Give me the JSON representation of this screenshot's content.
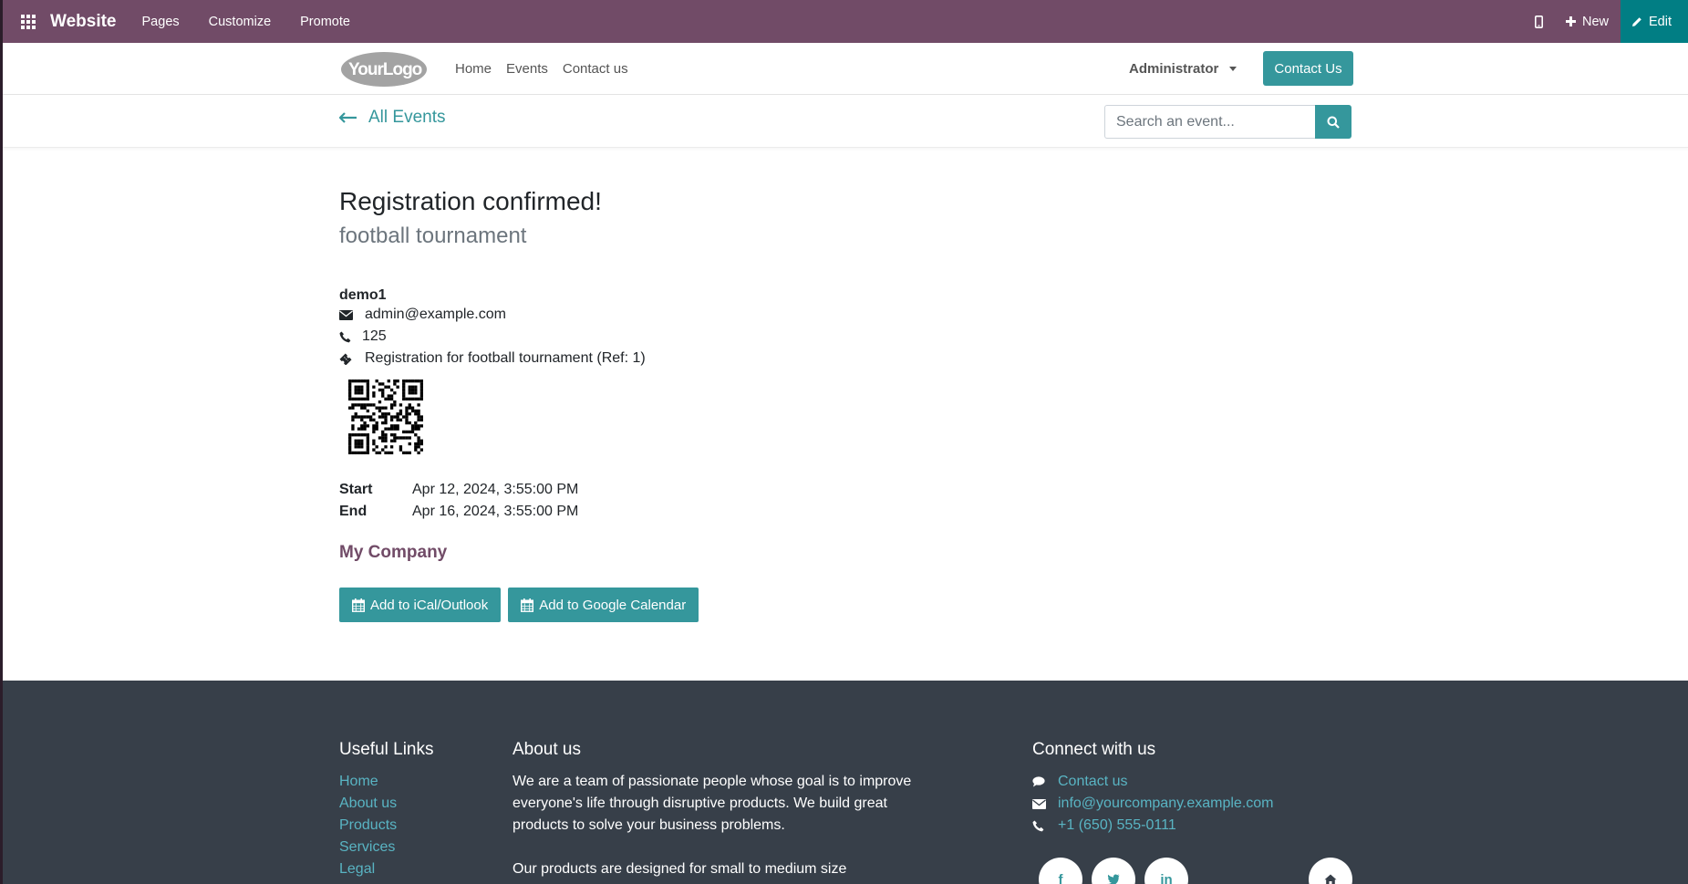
{
  "topbar": {
    "app_name": "Website",
    "menu": [
      "Pages",
      "Customize",
      "Promote"
    ],
    "new_label": "New",
    "edit_label": "Edit"
  },
  "header": {
    "logo_text": "YourLogo",
    "nav": [
      "Home",
      "Events",
      "Contact us"
    ],
    "user": "Administrator",
    "contact_button": "Contact Us"
  },
  "subheader": {
    "back_label": "All Events",
    "search_placeholder": "Search an event..."
  },
  "main": {
    "title": "Registration confirmed!",
    "event_name": "football tournament",
    "attendee": {
      "name": "demo1",
      "email": "admin@example.com",
      "phone": "125",
      "ticket": "Registration for football tournament (Ref: 1)"
    },
    "start_label": "Start",
    "start_value": "Apr 12, 2024, 3:55:00 PM",
    "end_label": "End",
    "end_value": "Apr 16, 2024, 3:55:00 PM",
    "organizer": "My Company",
    "ical_button": "Add to iCal/Outlook",
    "google_button": "Add to Google Calendar"
  },
  "footer": {
    "useful_links_title": "Useful Links",
    "useful_links": [
      "Home",
      "About us",
      "Products",
      "Services",
      "Legal"
    ],
    "about_title": "About us",
    "about_text_1": "We are a team of passionate people whose goal is to improve everyone's life through disruptive products. We build great products to solve your business problems.",
    "about_text_2": "Our products are designed for small to medium size",
    "connect_title": "Connect with us",
    "contact_link": "Contact us",
    "email": "info@yourcompany.example.com",
    "phone": "+1 (650) 555-0111",
    "social_icons": [
      "facebook-icon",
      "twitter-icon",
      "linkedin-icon",
      "home-icon"
    ]
  },
  "colors": {
    "topbar": "#714b67",
    "edit": "#017e84",
    "accent": "#35979c",
    "footer": "#373f49",
    "footer_link": "#59b4c3"
  }
}
